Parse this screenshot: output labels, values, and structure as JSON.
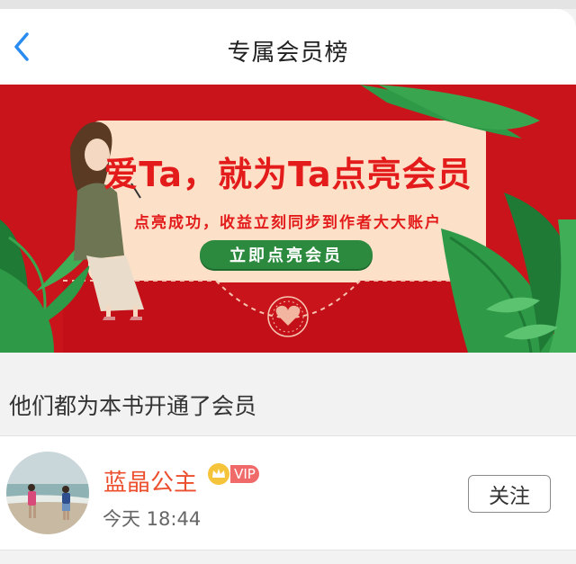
{
  "nav": {
    "back_icon": "chevron-left-icon",
    "title": "专属会员榜"
  },
  "banner": {
    "headline": "爱Ta，就为Ta点亮会员",
    "subline": "点亮成功，收益立刻同步到作者大大账户",
    "cta_label": "立即点亮会员",
    "colors": {
      "background": "#c8141a",
      "card": "#fde0c8",
      "accent_text": "#e31b1b",
      "cta": "#2c8a3e",
      "leaf": "#2e9a47"
    }
  },
  "section": {
    "title": "他们都为本书开通了会员"
  },
  "members": [
    {
      "name": "蓝晶公主",
      "badge": "VIP",
      "badge_icon": "crown-icon",
      "time": "今天 18:44",
      "follow_label": "关注",
      "avatar_icon": "beach-photo-avatar"
    }
  ]
}
